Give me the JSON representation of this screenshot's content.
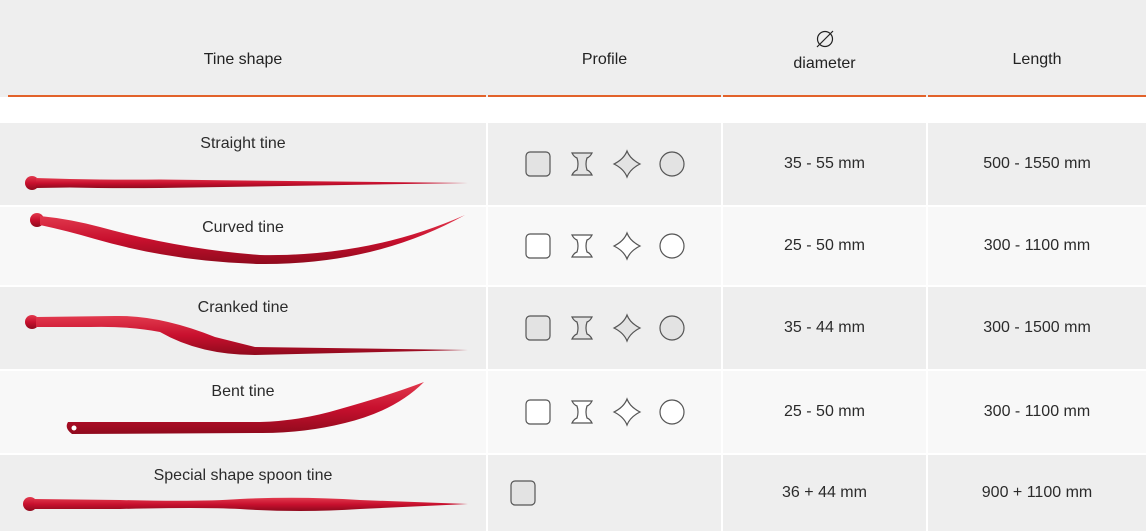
{
  "header": {
    "tine_shape": "Tine shape",
    "profile": "Profile",
    "diameter_symbol": "diameter-symbol",
    "diameter": "diameter",
    "length": "Length"
  },
  "accent_color": "#e2622a",
  "tine_color": "#c8102e",
  "rows": [
    {
      "name": "Straight tine",
      "profiles": [
        "square-icon",
        "double-t-icon",
        "star-icon",
        "circle-icon"
      ],
      "diameter": "35 - 55 mm",
      "length": "500 - 1550 mm"
    },
    {
      "name": "Curved tine",
      "profiles": [
        "square-icon",
        "double-t-icon",
        "star-icon",
        "circle-icon"
      ],
      "diameter": "25 - 50 mm",
      "length": "300 - 1100 mm"
    },
    {
      "name": "Cranked tine",
      "profiles": [
        "square-icon",
        "double-t-icon",
        "star-icon",
        "circle-icon"
      ],
      "diameter": "35 - 44 mm",
      "length": "300 - 1500 mm"
    },
    {
      "name": "Bent tine",
      "profiles": [
        "square-icon",
        "double-t-icon",
        "star-icon",
        "circle-icon"
      ],
      "diameter": "25 - 50 mm",
      "length": "300 - 1100 mm"
    },
    {
      "name": "Special shape spoon tine",
      "profiles": [
        "square-icon"
      ],
      "diameter": "36 + 44 mm",
      "length": "900 + 1100 mm"
    }
  ]
}
